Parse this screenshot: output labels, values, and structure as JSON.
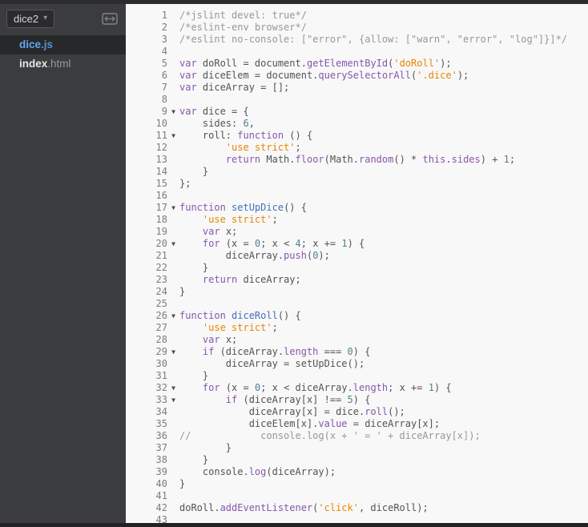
{
  "sidebar": {
    "project_dropdown": {
      "label": "dice2",
      "caret_icon": "chevron-down"
    },
    "split_view_icon": "split-view",
    "files": [
      {
        "name": "dice",
        "ext": ".js",
        "active": true
      },
      {
        "name": "index",
        "ext": ".html",
        "active": false
      }
    ]
  },
  "colors": {
    "sidebar_bg": "#3a3c3e",
    "active_file_bg": "#27282a",
    "active_file_text": "#61a9f1",
    "editor_bg": "#f8f8f8",
    "code_plain": "#535353",
    "keyword": "#8757ad",
    "property": "#8757ad",
    "string": "#e88501",
    "comment": "#979797",
    "number": "#538091",
    "function_def": "#446fbd",
    "line_number": "#7c7c7c"
  },
  "editor": {
    "lines": [
      {
        "n": 1,
        "fold": false,
        "tokens": [
          [
            "com",
            "/*jslint devel: true*/"
          ]
        ]
      },
      {
        "n": 2,
        "fold": false,
        "tokens": [
          [
            "com",
            "/*eslint-env browser*/"
          ]
        ]
      },
      {
        "n": 3,
        "fold": false,
        "tokens": [
          [
            "com",
            "/*eslint no-console: [\"error\", {allow: [\"warn\", \"error\", \"log\"]}]*/"
          ]
        ]
      },
      {
        "n": 4,
        "fold": false,
        "tokens": []
      },
      {
        "n": 5,
        "fold": false,
        "tokens": [
          [
            "kw",
            "var"
          ],
          [
            "",
            " doRoll = document."
          ],
          [
            "prop",
            "getElementById"
          ],
          [
            "",
            "("
          ],
          [
            "str",
            "'doRoll'"
          ],
          [
            "",
            ");"
          ]
        ]
      },
      {
        "n": 6,
        "fold": false,
        "tokens": [
          [
            "kw",
            "var"
          ],
          [
            "",
            " diceElem = document."
          ],
          [
            "prop",
            "querySelectorAll"
          ],
          [
            "",
            "("
          ],
          [
            "str",
            "'.dice'"
          ],
          [
            "",
            ");"
          ]
        ]
      },
      {
        "n": 7,
        "fold": false,
        "tokens": [
          [
            "kw",
            "var"
          ],
          [
            "",
            " diceArray = [];"
          ]
        ]
      },
      {
        "n": 8,
        "fold": false,
        "tokens": []
      },
      {
        "n": 9,
        "fold": true,
        "tokens": [
          [
            "kw",
            "var"
          ],
          [
            "",
            " dice = {"
          ]
        ]
      },
      {
        "n": 10,
        "fold": false,
        "tokens": [
          [
            "",
            "    sides: "
          ],
          [
            "num",
            "6"
          ],
          [
            "",
            ","
          ]
        ]
      },
      {
        "n": 11,
        "fold": true,
        "tokens": [
          [
            "",
            "    roll: "
          ],
          [
            "kw",
            "function"
          ],
          [
            "",
            " () {"
          ]
        ]
      },
      {
        "n": 12,
        "fold": false,
        "tokens": [
          [
            "",
            "        "
          ],
          [
            "str",
            "'use strict'"
          ],
          [
            "",
            ";"
          ]
        ]
      },
      {
        "n": 13,
        "fold": false,
        "tokens": [
          [
            "",
            "        "
          ],
          [
            "kw",
            "return"
          ],
          [
            "",
            " Math."
          ],
          [
            "prop",
            "floor"
          ],
          [
            "",
            "(Math."
          ],
          [
            "prop",
            "random"
          ],
          [
            "",
            "() * "
          ],
          [
            "kw",
            "this"
          ],
          [
            "",
            "."
          ],
          [
            "prop",
            "sides"
          ],
          [
            "",
            ") + "
          ],
          [
            "num",
            "1"
          ],
          [
            "",
            ";"
          ]
        ]
      },
      {
        "n": 14,
        "fold": false,
        "tokens": [
          [
            "",
            "    }"
          ]
        ]
      },
      {
        "n": 15,
        "fold": false,
        "tokens": [
          [
            "",
            "};"
          ]
        ]
      },
      {
        "n": 16,
        "fold": false,
        "tokens": []
      },
      {
        "n": 17,
        "fold": true,
        "tokens": [
          [
            "kw",
            "function"
          ],
          [
            "",
            " "
          ],
          [
            "def",
            "setUpDice"
          ],
          [
            "",
            "() {"
          ]
        ]
      },
      {
        "n": 18,
        "fold": false,
        "tokens": [
          [
            "",
            "    "
          ],
          [
            "str",
            "'use strict'"
          ],
          [
            "",
            ";"
          ]
        ]
      },
      {
        "n": 19,
        "fold": false,
        "tokens": [
          [
            "",
            "    "
          ],
          [
            "kw",
            "var"
          ],
          [
            "",
            " x;"
          ]
        ]
      },
      {
        "n": 20,
        "fold": true,
        "tokens": [
          [
            "",
            "    "
          ],
          [
            "kw",
            "for"
          ],
          [
            "",
            " (x = "
          ],
          [
            "num",
            "0"
          ],
          [
            "",
            "; x < "
          ],
          [
            "num",
            "4"
          ],
          [
            "",
            "; x += "
          ],
          [
            "num",
            "1"
          ],
          [
            "",
            ") {"
          ]
        ]
      },
      {
        "n": 21,
        "fold": false,
        "tokens": [
          [
            "",
            "        diceArray."
          ],
          [
            "prop",
            "push"
          ],
          [
            "",
            "("
          ],
          [
            "num",
            "0"
          ],
          [
            "",
            ");"
          ]
        ]
      },
      {
        "n": 22,
        "fold": false,
        "tokens": [
          [
            "",
            "    }"
          ]
        ]
      },
      {
        "n": 23,
        "fold": false,
        "tokens": [
          [
            "",
            "    "
          ],
          [
            "kw",
            "return"
          ],
          [
            "",
            " diceArray;"
          ]
        ]
      },
      {
        "n": 24,
        "fold": false,
        "tokens": [
          [
            "",
            "}"
          ]
        ]
      },
      {
        "n": 25,
        "fold": false,
        "tokens": []
      },
      {
        "n": 26,
        "fold": true,
        "tokens": [
          [
            "kw",
            "function"
          ],
          [
            "",
            " "
          ],
          [
            "def",
            "diceRoll"
          ],
          [
            "",
            "() {"
          ]
        ]
      },
      {
        "n": 27,
        "fold": false,
        "tokens": [
          [
            "",
            "    "
          ],
          [
            "str",
            "'use strict'"
          ],
          [
            "",
            ";"
          ]
        ]
      },
      {
        "n": 28,
        "fold": false,
        "tokens": [
          [
            "",
            "    "
          ],
          [
            "kw",
            "var"
          ],
          [
            "",
            " x;"
          ]
        ]
      },
      {
        "n": 29,
        "fold": true,
        "tokens": [
          [
            "",
            "    "
          ],
          [
            "kw",
            "if"
          ],
          [
            "",
            " (diceArray."
          ],
          [
            "prop",
            "length"
          ],
          [
            "",
            " === "
          ],
          [
            "num",
            "0"
          ],
          [
            "",
            ") {"
          ]
        ]
      },
      {
        "n": 30,
        "fold": false,
        "tokens": [
          [
            "",
            "        diceArray = setUpDice();"
          ]
        ]
      },
      {
        "n": 31,
        "fold": false,
        "tokens": [
          [
            "",
            "    }"
          ]
        ]
      },
      {
        "n": 32,
        "fold": true,
        "tokens": [
          [
            "",
            "    "
          ],
          [
            "kw",
            "for"
          ],
          [
            "",
            " (x = "
          ],
          [
            "num",
            "0"
          ],
          [
            "",
            "; x < diceArray."
          ],
          [
            "prop",
            "length"
          ],
          [
            "",
            "; x += "
          ],
          [
            "num",
            "1"
          ],
          [
            "",
            ") {"
          ]
        ]
      },
      {
        "n": 33,
        "fold": true,
        "tokens": [
          [
            "",
            "        "
          ],
          [
            "kw",
            "if"
          ],
          [
            "",
            " (diceArray[x] !== "
          ],
          [
            "num",
            "5"
          ],
          [
            "",
            ") {"
          ]
        ]
      },
      {
        "n": 34,
        "fold": false,
        "tokens": [
          [
            "",
            "            diceArray[x] = dice."
          ],
          [
            "prop",
            "roll"
          ],
          [
            "",
            "();"
          ]
        ]
      },
      {
        "n": 35,
        "fold": false,
        "tokens": [
          [
            "",
            "            diceElem[x]."
          ],
          [
            "prop",
            "value"
          ],
          [
            "",
            " = diceArray[x];"
          ]
        ]
      },
      {
        "n": 36,
        "fold": false,
        "tokens": [
          [
            "com",
            "//            console.log(x + ' = ' + diceArray[x]);"
          ]
        ]
      },
      {
        "n": 37,
        "fold": false,
        "tokens": [
          [
            "",
            "        }"
          ]
        ]
      },
      {
        "n": 38,
        "fold": false,
        "tokens": [
          [
            "",
            "    }"
          ]
        ]
      },
      {
        "n": 39,
        "fold": false,
        "tokens": [
          [
            "",
            "    console."
          ],
          [
            "prop",
            "log"
          ],
          [
            "",
            "(diceArray);"
          ]
        ]
      },
      {
        "n": 40,
        "fold": false,
        "tokens": [
          [
            "",
            "}"
          ]
        ]
      },
      {
        "n": 41,
        "fold": false,
        "tokens": []
      },
      {
        "n": 42,
        "fold": false,
        "tokens": [
          [
            "",
            "doRoll."
          ],
          [
            "prop",
            "addEventListener"
          ],
          [
            "",
            "("
          ],
          [
            "str",
            "'click'"
          ],
          [
            "",
            ", diceRoll);"
          ]
        ]
      },
      {
        "n": 43,
        "fold": false,
        "tokens": []
      }
    ]
  }
}
